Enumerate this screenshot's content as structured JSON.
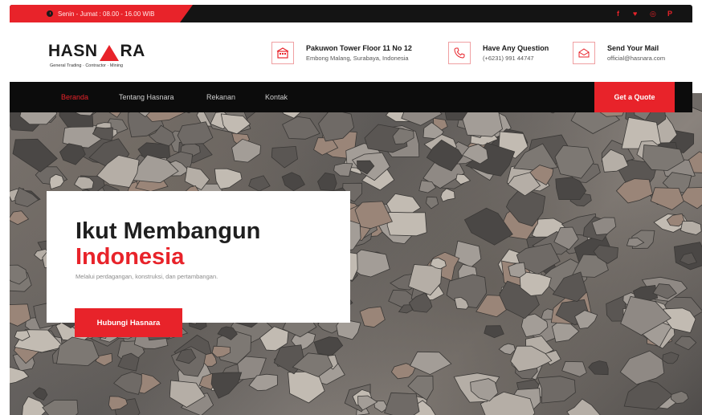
{
  "topbar": {
    "hours": "Senin - Jumat : 08.00 - 16.00 WIB",
    "social": [
      {
        "icon": "facebook-icon",
        "glyph": "f"
      },
      {
        "icon": "twitter-icon",
        "glyph": "♥"
      },
      {
        "icon": "instagram-icon",
        "glyph": "◎"
      },
      {
        "icon": "pinterest-icon",
        "glyph": "P"
      }
    ],
    "accent": "#e8232a"
  },
  "logo": {
    "part1": "HASN",
    "part2": "RA",
    "tagline": "General Trading · Contractor · Mining"
  },
  "info": [
    {
      "icon": "building-icon",
      "title": "Pakuwon Tower Floor 11 No 12",
      "sub": "Embong Malang, Surabaya, Indonesia"
    },
    {
      "icon": "phone-icon",
      "title": "Have Any Question",
      "sub": "(+6231) 991 44747"
    },
    {
      "icon": "mail-icon",
      "title": "Send Your Mail",
      "sub": "official@hasnara.com"
    }
  ],
  "nav": {
    "items": [
      "Beranda",
      "Tentang Hasnara",
      "Rekanan",
      "Kontak"
    ],
    "active_index": 0,
    "quote": "Get a Quote"
  },
  "hero": {
    "line1": "Ikut Membangun",
    "line2": "Indonesia",
    "sub": "Melalui perdagangan, konstruksi, dan pertambangan.",
    "button": "Hubungi Hasnara"
  }
}
